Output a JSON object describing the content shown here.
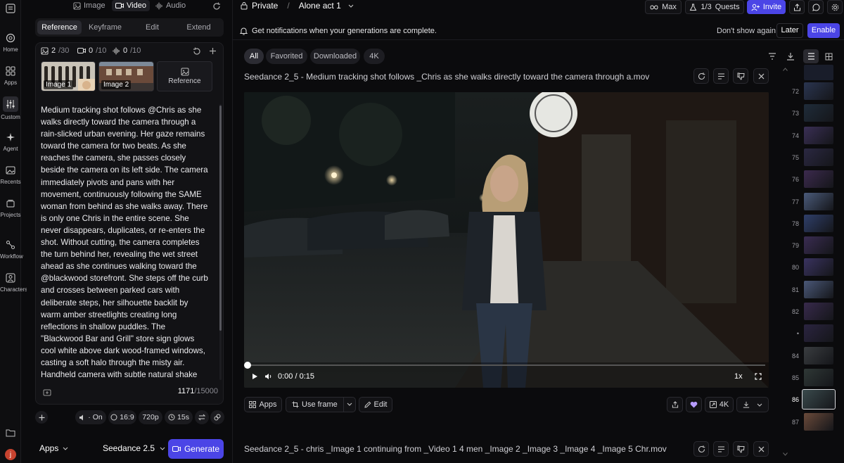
{
  "nav": {
    "items": [
      {
        "label": "Home",
        "icon": "home-icon"
      },
      {
        "label": "Apps",
        "icon": "apps-grid-icon"
      },
      {
        "label": "Custom",
        "icon": "sliders-icon"
      },
      {
        "label": "Agent",
        "icon": "sparkle-icon"
      },
      {
        "label": "Recents",
        "icon": "image-gallery-icon"
      },
      {
        "label": "Projects",
        "icon": "layers-icon"
      },
      {
        "label": "Workflow",
        "icon": "workflow-icon"
      },
      {
        "label": "Characters",
        "icon": "person-icon"
      }
    ],
    "avatar_letter": "j"
  },
  "panel": {
    "media_tabs": [
      "Image",
      "Video",
      "Audio"
    ],
    "active_media_tab": "Video",
    "sub_tabs": [
      "Reference",
      "Keyframe",
      "Edit",
      "Extend"
    ],
    "active_sub_tab": "Reference",
    "counts": {
      "images": "2",
      "images_max": "/30",
      "videos": "0",
      "videos_max": "/10",
      "audio": "0",
      "audio_max": "/10"
    },
    "thumbs": [
      {
        "label": "Image 1"
      },
      {
        "label": "Image 2"
      }
    ],
    "reference_label": "Reference",
    "prompt": "Medium tracking shot follows @Chris as she walks directly toward the camera through a rain-slicked urban evening. Her gaze remains toward the camera for two beats. As she reaches the camera, she passes closely beside the camera on its left side. The camera immediately pivots and pans with her movement, continuously following the SAME woman from behind as she walks away. There is only one Chris in the entire scene. She never disappears, duplicates, or re-enters the shot. Without cutting, the camera completes the turn behind her, revealing the wet street ahead as she continues walking toward the @blackwood storefront. She steps off the curb and crosses between parked cars with deliberate steps, her silhouette backlit by warm amber streetlights creating long reflections in shallow puddles. The \"Blackwood Bar and Grill\" store sign glows cool white above dark wood-framed windows, casting a soft halo through the misty air. Handheld camera with subtle natural shake continuously follows her movement. Muted city ambience, distant traffic, footsteps on",
    "char_count": "1171",
    "char_max": "/15000",
    "options": {
      "audio": "On",
      "aspect": "16:9",
      "resolution": "720p",
      "duration": "15s"
    },
    "apps_label": "Apps",
    "model_label": "Seedance 2.5",
    "generate_label": "Generate"
  },
  "header": {
    "privacy": "Private",
    "separator": "/",
    "project": "Alone act 1",
    "max_label": "Max",
    "quests_count": "1/3",
    "quests_label": "Quests",
    "invite_label": "Invite"
  },
  "notification": {
    "text": "Get notifications when your generations are complete.",
    "dismiss": "Don't show again",
    "later": "Later",
    "enable": "Enable"
  },
  "filters": [
    "All",
    "Favorited",
    "Downloaded",
    "4K"
  ],
  "active_filter": "All",
  "generation1": {
    "title": "Seedance 2_5 - Medium tracking shot follows _Chris as she walks directly toward the camera through a.mov",
    "time": "0:00 / 0:15",
    "speed": "1x",
    "actions": {
      "apps": "Apps",
      "use_frame": "Use frame",
      "edit": "Edit",
      "quality": "4K"
    }
  },
  "generation2": {
    "title": "Seedance 2_5 - chris _Image 1 continuing from _Video 1 4 men _Image 2 _Image 3 _Image 4 _Image 5 Chr.mov"
  },
  "filmstrip": {
    "items": [
      {
        "num": "72"
      },
      {
        "num": "73"
      },
      {
        "num": "74"
      },
      {
        "num": "75"
      },
      {
        "num": "76"
      },
      {
        "num": "77"
      },
      {
        "num": "78"
      },
      {
        "num": "79"
      },
      {
        "num": "80"
      },
      {
        "num": "81"
      },
      {
        "num": "82"
      },
      {
        "num": "•"
      },
      {
        "num": "84"
      },
      {
        "num": "85"
      },
      {
        "num": "86"
      },
      {
        "num": "87"
      }
    ],
    "active": "86"
  },
  "colors": {
    "accent": "#4b45e6",
    "bg": "#0b0b0d",
    "panel": "#121215"
  }
}
